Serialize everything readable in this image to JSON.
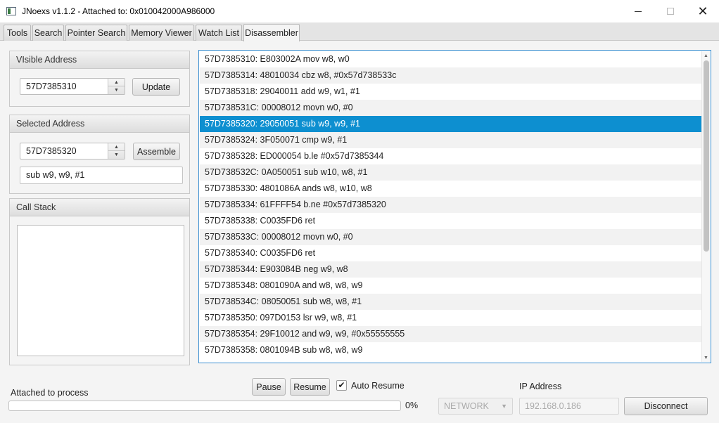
{
  "window": {
    "title": "JNoexs v1.1.2 - Attached to: 0x010042000A986000",
    "minimize": "",
    "maximize": "",
    "close": "✕"
  },
  "tabs": [
    {
      "label": "Tools"
    },
    {
      "label": "Search"
    },
    {
      "label": "Pointer Search"
    },
    {
      "label": "Memory Viewer"
    },
    {
      "label": "Watch List"
    },
    {
      "label": "Disassembler",
      "active": true
    }
  ],
  "visible_address": {
    "header": "VIsible Address",
    "value": "57D7385310",
    "update_label": "Update"
  },
  "selected_address": {
    "header": "Selected Address",
    "value": "57D7385320",
    "assemble_label": "Assemble",
    "instruction": "sub w9, w9, #1"
  },
  "call_stack": {
    "header": "Call Stack"
  },
  "disassembly": {
    "selected_index": 4,
    "rows": [
      "57D7385310: E803002A mov w8, w0",
      "57D7385314: 48010034 cbz w8, #0x57d738533c",
      "57D7385318: 29040011 add w9, w1, #1",
      "57D738531C: 00008012 movn w0, #0",
      "57D7385320: 29050051 sub w9, w9, #1",
      "57D7385324: 3F050071 cmp w9, #1",
      "57D7385328: ED000054 b.le #0x57d7385344",
      "57D738532C: 0A050051 sub w10, w8, #1",
      "57D7385330: 4801086A ands w8, w10, w8",
      "57D7385334: 61FFFF54 b.ne #0x57d7385320",
      "57D7385338: C0035FD6 ret",
      "57D738533C: 00008012 movn w0, #0",
      "57D7385340: C0035FD6 ret",
      "57D7385344: E903084B neg w9, w8",
      "57D7385348: 0801090A and w8, w8, w9",
      "57D738534C: 08050051 sub w8, w8, #1",
      "57D7385350: 097D0153 lsr w9, w8, #1",
      "57D7385354: 29F10012 and w9, w9, #0x55555555",
      "57D7385358: 0801094B sub w8, w8, w9"
    ]
  },
  "status": {
    "label": "Attached to process",
    "progress_fraction": 0,
    "progress_text": "0%",
    "pause_label": "Pause",
    "resume_label": "Resume",
    "auto_resume_label": "Auto Resume",
    "auto_resume_checked": true,
    "connection_type": "NETWORK",
    "ip_label": "IP Address",
    "ip_value": "192.168.0.186",
    "disconnect_label": "Disconnect"
  },
  "colors": {
    "selection": "#0d8fd0",
    "focus_border": "#3b8fd0"
  }
}
